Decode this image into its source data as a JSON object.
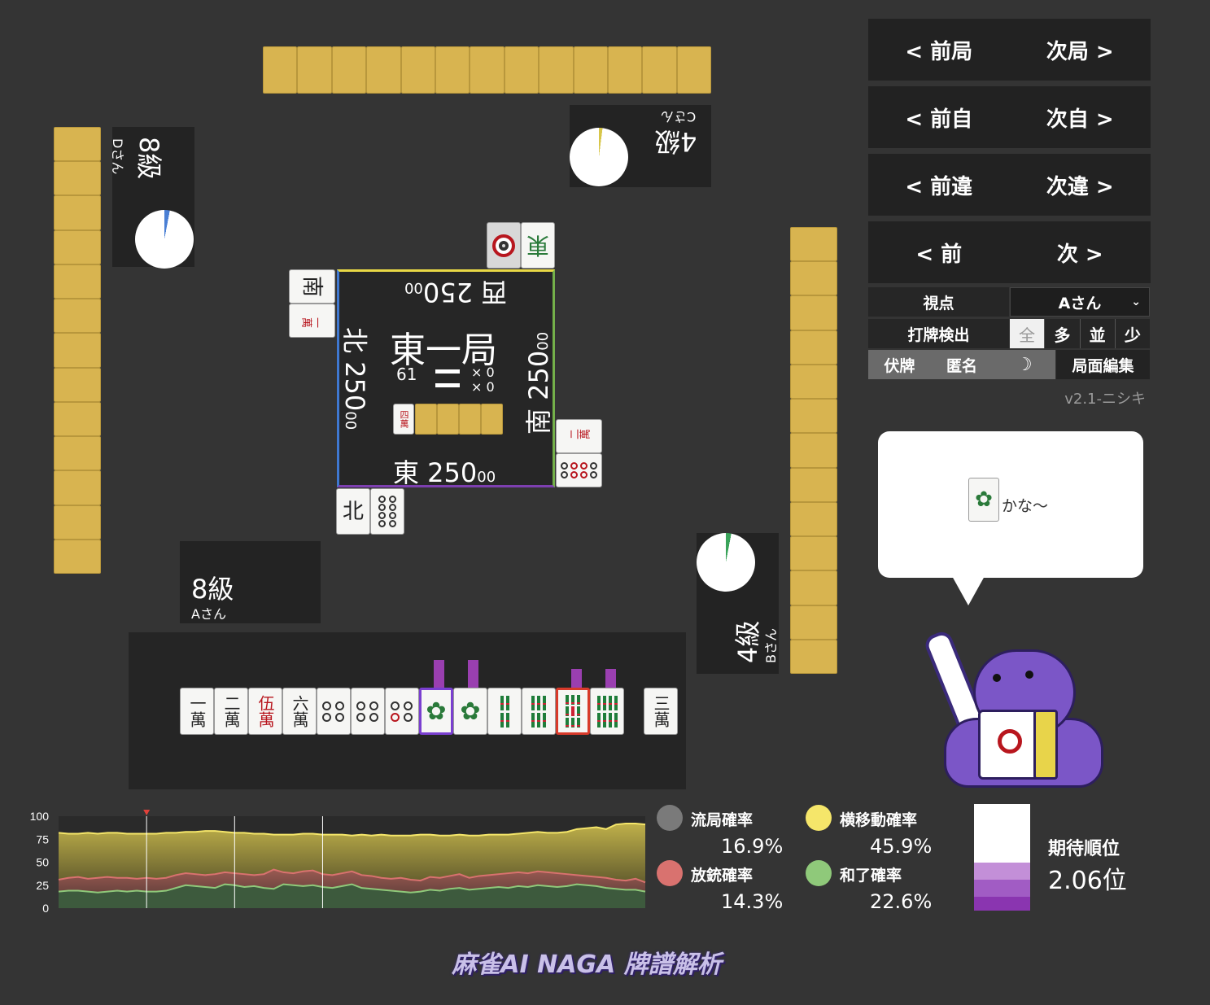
{
  "nav": [
    {
      "prev": "< 前局",
      "next": "次局 >"
    },
    {
      "prev": "< 前自",
      "next": "次自 >"
    },
    {
      "prev": "< 前違",
      "next": "次違 >"
    },
    {
      "prev": "< 前",
      "next": "次 >"
    }
  ],
  "controls": {
    "viewpoint_label": "視点",
    "viewpoint_value": "Aさん",
    "discard_detect_label": "打牌検出",
    "detect_options": [
      "全",
      "多",
      "並",
      "少"
    ],
    "hide_tiles": "伏牌",
    "anonymous": "匿名",
    "board_edit": "局面編集",
    "version": "v2.1-ニシキ"
  },
  "speech": {
    "text": "かな～"
  },
  "players": {
    "self": {
      "rank": "8級",
      "name": "Aさん"
    },
    "right": {
      "rank": "4級",
      "name": "Bさん"
    },
    "top": {
      "rank": "4級",
      "name": "Cさん"
    },
    "left": {
      "rank": "8級",
      "name": "Dさん"
    }
  },
  "center": {
    "round": "東一局",
    "tiles_left": "61",
    "honba": "× 0",
    "riichi": "× 0",
    "dora_indicator": "四萬",
    "east_score": "東 250",
    "south_score": "南 250",
    "west_score": "西 250",
    "north_score": "北 250",
    "score_suffix": "00"
  },
  "discards": {
    "top": [
      "東"
    ],
    "left": [
      "南",
      "一萬"
    ],
    "right": [
      "二萬"
    ],
    "bottom": [
      "北"
    ]
  },
  "hand": {
    "tiles": [
      "一萬",
      "二萬",
      "伍萬",
      "六萬",
      "四筒",
      "四筒",
      "五筒",
      "一索",
      "一索",
      "四索",
      "六索",
      "九索",
      "八索"
    ],
    "drawn": "三萬"
  },
  "chart_data": {
    "type": "area",
    "ylim": [
      0,
      100
    ],
    "yticks": [
      0,
      25,
      50,
      75,
      100
    ],
    "x": [
      0,
      1,
      2,
      3,
      4,
      5,
      6,
      7,
      8,
      9,
      10,
      11,
      12,
      13,
      14,
      15,
      16,
      17,
      18,
      19,
      20,
      21,
      22,
      23,
      24,
      25,
      26,
      27,
      28,
      29,
      30,
      31,
      32,
      33,
      34,
      35,
      36,
      37,
      38,
      39,
      40,
      41,
      42,
      43,
      44,
      45,
      46,
      47,
      48,
      49,
      50,
      51,
      52,
      53,
      54,
      55,
      56,
      57,
      58,
      59,
      60
    ],
    "series": [
      {
        "name": "横移動確率",
        "color": "#f5e66a",
        "values": [
          82,
          81,
          81,
          82,
          81,
          82,
          82,
          81,
          81,
          81,
          81,
          82,
          82,
          83,
          83,
          84,
          84,
          83,
          82,
          82,
          81,
          81,
          80,
          80,
          80,
          81,
          81,
          80,
          80,
          80,
          79,
          80,
          79,
          80,
          79,
          79,
          79,
          80,
          80,
          79,
          79,
          80,
          79,
          79,
          80,
          80,
          80,
          81,
          82,
          83,
          82,
          82,
          83,
          86,
          87,
          88,
          86,
          91,
          92,
          92,
          91
        ]
      },
      {
        "name": "放銃確率",
        "color": "#d9726f",
        "values": [
          31,
          33,
          34,
          32,
          33,
          34,
          33,
          33,
          32,
          33,
          32,
          33,
          36,
          38,
          37,
          36,
          37,
          39,
          38,
          37,
          36,
          37,
          42,
          39,
          38,
          40,
          41,
          37,
          36,
          38,
          40,
          36,
          35,
          33,
          32,
          33,
          31,
          30,
          34,
          33,
          35,
          37,
          33,
          35,
          36,
          37,
          38,
          39,
          38,
          40,
          39,
          38,
          37,
          36,
          35,
          34,
          33,
          31,
          30,
          32,
          28
        ]
      },
      {
        "name": "和了確率",
        "color": "#8fc97a",
        "values": [
          18,
          19,
          19,
          18,
          17,
          18,
          19,
          18,
          19,
          18,
          18,
          19,
          22,
          25,
          24,
          23,
          22,
          26,
          25,
          23,
          24,
          22,
          21,
          26,
          25,
          24,
          25,
          23,
          22,
          24,
          26,
          22,
          21,
          20,
          19,
          18,
          17,
          18,
          20,
          19,
          21,
          22,
          20,
          21,
          22,
          23,
          22,
          24,
          23,
          25,
          24,
          23,
          24,
          26,
          25,
          24,
          22,
          21,
          20,
          20,
          18
        ]
      }
    ],
    "vlines": [
      9,
      18,
      27
    ],
    "marker": 9
  },
  "legend": [
    {
      "label": "流局確率",
      "value": "16.9%",
      "color": "#7a7a7a"
    },
    {
      "label": "放銃確率",
      "value": "14.3%",
      "color": "#d9726f"
    },
    {
      "label": "横移動確率",
      "value": "45.9%",
      "color": "#f5e66a"
    },
    {
      "label": "和了確率",
      "value": "22.6%",
      "color": "#8fc97a"
    }
  ],
  "rank_bar": {
    "label": "期待順位",
    "value": "2.06位",
    "segments": [
      0.55,
      0.16,
      0.16,
      0.13
    ]
  },
  "logo": {
    "text": "麻雀AI NAGA 牌譜解析"
  }
}
